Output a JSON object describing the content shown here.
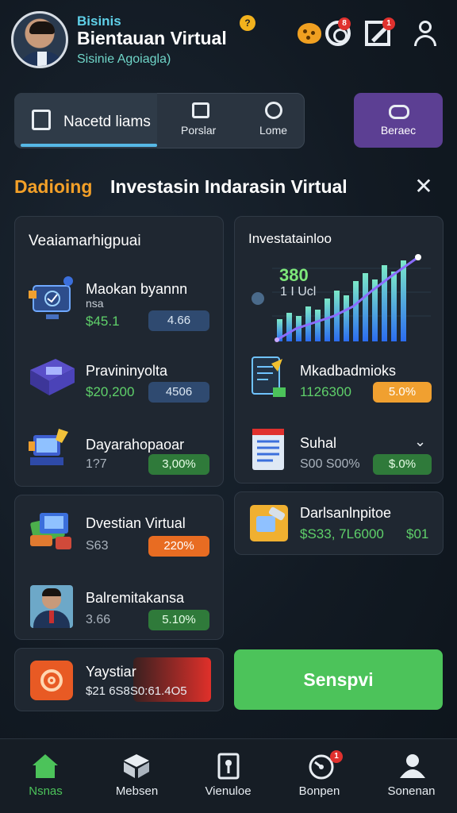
{
  "header": {
    "small_title": "Bisinis",
    "title": "Bientauan Virtual",
    "subtitle": "Sisinie Agoiagla)",
    "title_badge": "?",
    "notif_badge_1": "8",
    "notif_badge_2": "1",
    "icons": [
      "avatar",
      "cookie-icon",
      "target-icon",
      "z-icon",
      "user-icon"
    ]
  },
  "tabs": {
    "active_label": "Nacetd liams",
    "tab2_label": "Porslar",
    "tab3_label": "Lome",
    "promo_label": "Beraec"
  },
  "section": {
    "prefix": "Dadioing",
    "title": "Investasin Indarasin Virtual"
  },
  "left_card": {
    "title": "Veaiamarhigpuai",
    "items": [
      {
        "name": "Maokan byannn",
        "sub": "nsa",
        "value": "$45.1",
        "pill": "4.66",
        "pill_color": "#2f4a70"
      },
      {
        "name": "Pravininyolta",
        "value": "$20,200",
        "pill": "4506",
        "pill_color": "#2f4a70"
      },
      {
        "name": "Dayarahopaoar",
        "value": "1?7",
        "pill": "3,00%",
        "pill_color": "#2f7a3a"
      }
    ]
  },
  "right_card": {
    "title": "Investatainloo",
    "chart_number": "380",
    "chart_sub": "1 I Ucl",
    "items": [
      {
        "name": "Mkadbadmioks",
        "value": "1126300",
        "pill": "5.0%",
        "pill_color": "#f0a030"
      },
      {
        "name": "Suhal",
        "value": "S00 S00%",
        "pill": "$.0%",
        "pill_color": "#2f7a3a"
      }
    ]
  },
  "left_card2": {
    "items": [
      {
        "name": "Dvestian Virtual",
        "value": "S63",
        "pill": "220%",
        "pill_color": "#e86c22"
      },
      {
        "name": "Balremitakansa",
        "value": "3.66",
        "pill": "5.10%",
        "pill_color": "#2f7a3a"
      }
    ]
  },
  "right_card2": {
    "name": "Darlsanlnpitoe",
    "value": "$S33, 7L6000",
    "value2": "$01"
  },
  "bottom_card": {
    "name": "Yaystiar",
    "value": "$21 6S8S0:61.4O5"
  },
  "cta_label": "Senspvi",
  "nav": [
    {
      "label": "Nsnas",
      "icon": "home-icon",
      "active": true
    },
    {
      "label": "Mebsen",
      "icon": "box-icon",
      "active": false
    },
    {
      "label": "Vienuloe",
      "icon": "document-icon",
      "active": false
    },
    {
      "label": "Bonpen",
      "icon": "timer-icon",
      "active": false
    },
    {
      "label": "Sonenan",
      "icon": "profile-icon",
      "active": false
    }
  ],
  "nav_badge": "1",
  "colors": {
    "accent_green": "#4cc35a",
    "accent_orange": "#f3a028",
    "accent_purple": "#5c3f93",
    "value_green": "#5fd06a"
  }
}
